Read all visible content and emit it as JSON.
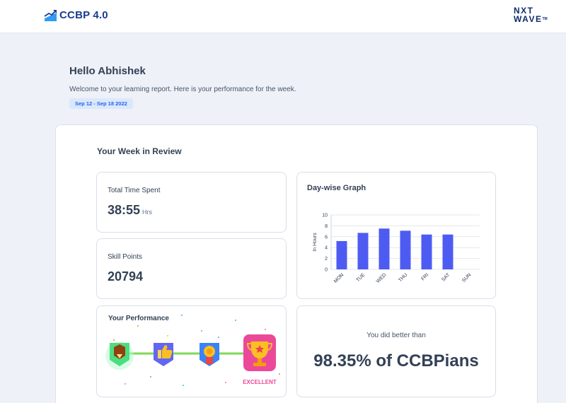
{
  "header": {
    "brand": "CCBP 4.0",
    "partner_logo_line1": "NXT",
    "partner_logo_line2": "WAVE",
    "partner_logo_tm": "TM"
  },
  "greeting": "Hello Abhishek",
  "welcome_text": "Welcome to your learning report. Here is your performance for the week.",
  "date_range": "Sep 12 - Sep 18 2022",
  "week_review": {
    "title": "Your Week in Review",
    "time_spent": {
      "label": "Total Time Spent",
      "value": "38:55",
      "unit": "Hrs"
    },
    "skill_points": {
      "label": "Skill Points",
      "value": "20794"
    },
    "graph_title": "Day-wise Graph",
    "performance": {
      "label": "Your Performance",
      "level": "EXCELLENT",
      "icons": [
        "pencil-badge-icon",
        "thumbs-up-badge-icon",
        "medal-badge-icon",
        "trophy-badge-icon"
      ]
    },
    "comparison": {
      "text": "You did better than",
      "value": "98.35% of CCBPians"
    }
  },
  "colors": {
    "bar": "#4e5bf2",
    "brand": "#183b8f",
    "accent": "#2563eb",
    "excellent": "#ec4899",
    "track": "#7ed957"
  },
  "chart_data": {
    "type": "bar",
    "categories": [
      "MON",
      "TUE",
      "WED",
      "THU",
      "FRI",
      "SAT",
      "SUN"
    ],
    "values": [
      5.2,
      6.7,
      7.5,
      7.1,
      6.4,
      6.4,
      0
    ],
    "title": "Day-wise Graph",
    "xlabel": "",
    "ylabel": "In Hours",
    "ylim": [
      0,
      10
    ],
    "yticks": [
      0,
      2,
      4,
      6,
      8,
      10
    ],
    "grid": true
  }
}
